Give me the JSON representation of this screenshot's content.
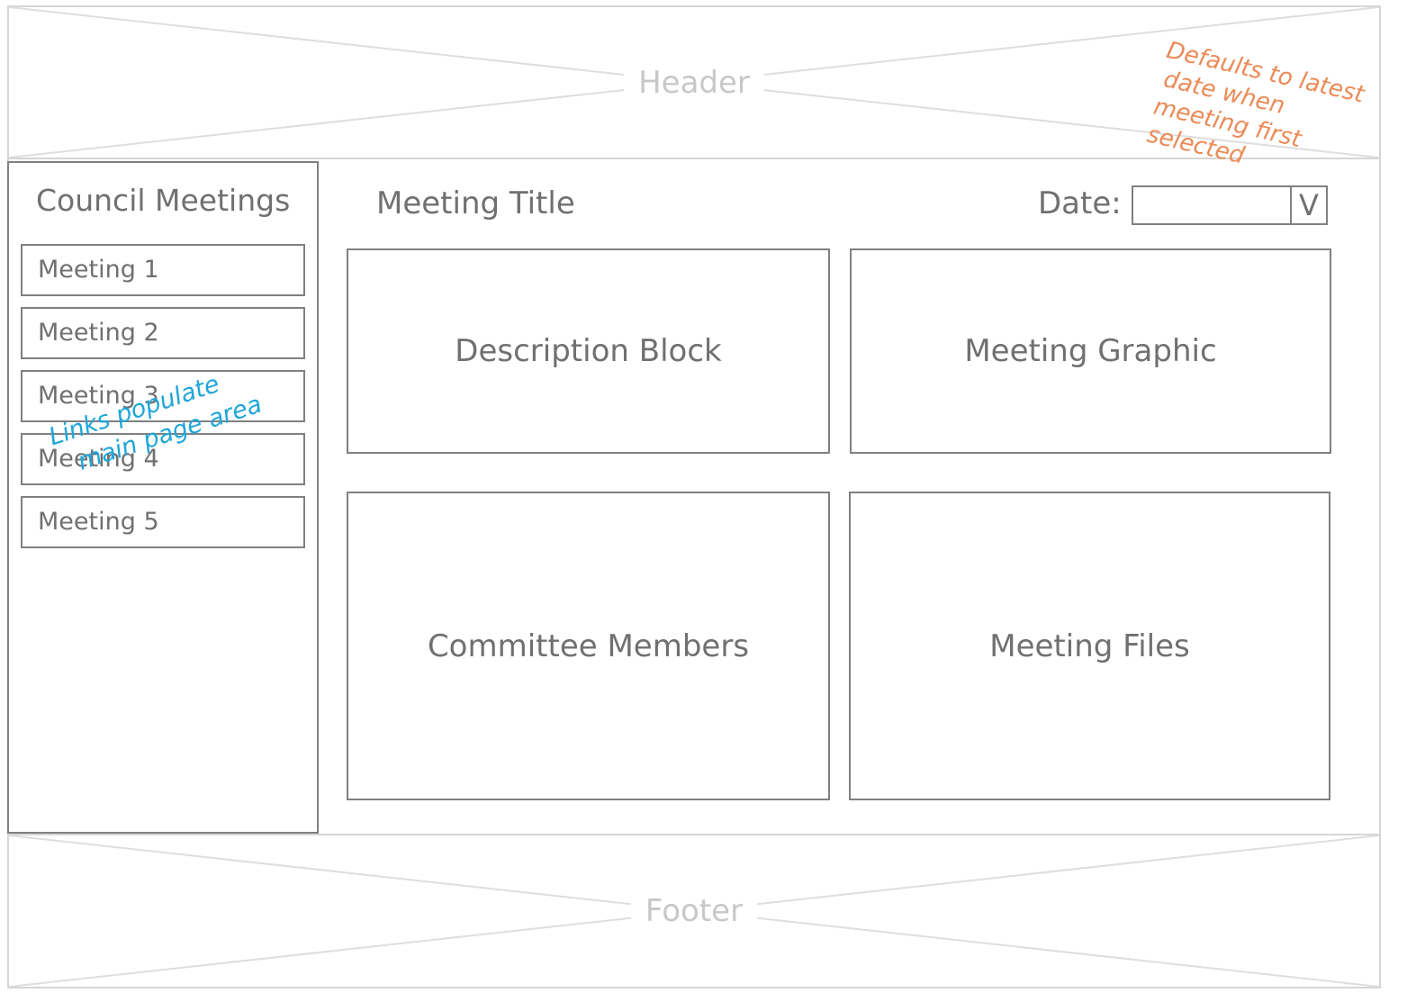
{
  "header": {
    "label": "Header"
  },
  "footer": {
    "label": "Footer"
  },
  "sidebar": {
    "title": "Council Meetings",
    "items": [
      {
        "label": "Meeting 1"
      },
      {
        "label": "Meeting 2"
      },
      {
        "label": "Meeting 3"
      },
      {
        "label": "Meeting 4"
      },
      {
        "label": "Meeting 5"
      }
    ],
    "note": {
      "line1": "Links populate",
      "line2": "main page area"
    }
  },
  "main": {
    "title": "Meeting Title",
    "date": {
      "label": "Date:",
      "value": "",
      "toggle": "V"
    },
    "blocks": {
      "description": "Description Block",
      "graphic": "Meeting Graphic",
      "members": "Committee Members",
      "files": "Meeting Files"
    },
    "note": {
      "line1": "Defaults to latest",
      "line2": "date when",
      "line3": "meeting first",
      "line4": "selected"
    }
  },
  "colors": {
    "border": "#808080",
    "placeholder_border": "#d6d6d6",
    "text": "#707070",
    "note_blue": "#1ea6d8",
    "note_orange": "#ec8a56"
  }
}
